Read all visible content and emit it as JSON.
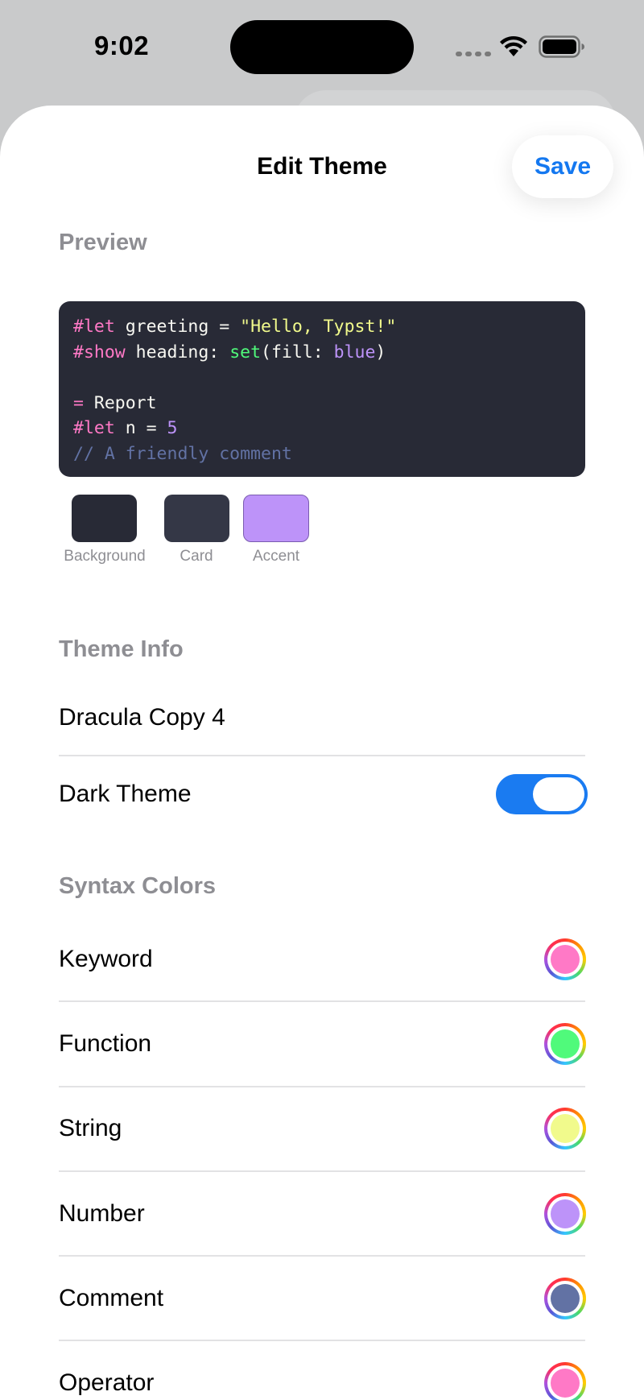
{
  "status_bar": {
    "time": "9:02"
  },
  "sheet": {
    "title": "Edit Theme",
    "save_label": "Save"
  },
  "preview": {
    "section_title": "Preview",
    "code_lines": [
      [
        {
          "t": "#let",
          "c": "keyword"
        },
        {
          "t": " greeting = ",
          "c": "plain"
        },
        {
          "t": "\"Hello, Typst!\"",
          "c": "string"
        }
      ],
      [
        {
          "t": "#show",
          "c": "keyword"
        },
        {
          "t": " heading: ",
          "c": "plain"
        },
        {
          "t": "set",
          "c": "function"
        },
        {
          "t": "(fill: ",
          "c": "plain"
        },
        {
          "t": "blue",
          "c": "number"
        },
        {
          "t": ")",
          "c": "plain"
        }
      ],
      [],
      [
        {
          "t": "=",
          "c": "operator"
        },
        {
          "t": " Report",
          "c": "plain"
        }
      ],
      [
        {
          "t": "#let",
          "c": "keyword"
        },
        {
          "t": " n = ",
          "c": "plain"
        },
        {
          "t": "5",
          "c": "number"
        }
      ],
      [
        {
          "t": "// A friendly comment",
          "c": "comment"
        }
      ]
    ],
    "swatches": [
      {
        "label": "Background",
        "color": "#282a36"
      },
      {
        "label": "Card",
        "color": "#343746"
      },
      {
        "label": "Accent",
        "color": "#bd93f9"
      }
    ]
  },
  "theme_info": {
    "section_title": "Theme Info",
    "name_value": "Dracula Copy 4",
    "dark_theme_label": "Dark Theme",
    "dark_theme_on": true
  },
  "syntax_colors": {
    "section_title": "Syntax Colors",
    "items": [
      {
        "label": "Keyword",
        "color": "#ff79c6"
      },
      {
        "label": "Function",
        "color": "#50fa7b"
      },
      {
        "label": "String",
        "color": "#f1fa8c"
      },
      {
        "label": "Number",
        "color": "#bd93f9"
      },
      {
        "label": "Comment",
        "color": "#6272a4"
      },
      {
        "label": "Operator",
        "color": "#ff79c6"
      }
    ]
  }
}
